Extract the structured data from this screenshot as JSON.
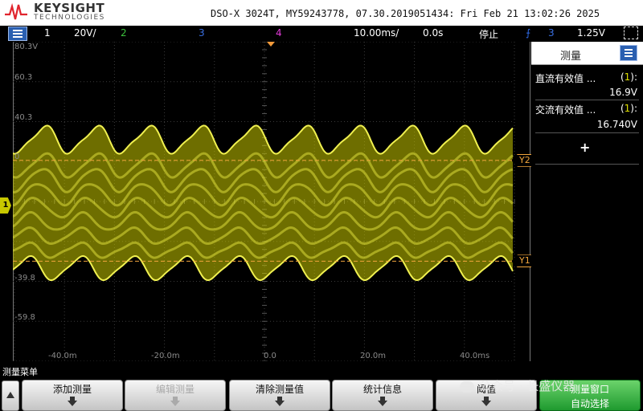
{
  "header": {
    "brand": "KEYSIGHT",
    "brand_sub": "TECHNOLOGIES",
    "scope_info": "DSO-X 3024T, MY59243778, 07.30.2019051434: Fri Feb 21 13:02:26 2025"
  },
  "statusbar": {
    "ch1_num": "1",
    "ch1_scale": "20V/",
    "ch2_num": "2",
    "ch3_num": "3",
    "ch4_num": "4",
    "timebase": "10.00ms/",
    "delay": "0.0s",
    "run_state": "停止",
    "trigger_source": "3",
    "trigger_level": "1.25V"
  },
  "plot": {
    "y_labels": [
      "80.3V",
      "60.3",
      "40.3",
      "0",
      "-39.8",
      "-59.8"
    ],
    "x_labels": [
      "-40.0m",
      "-20.0m",
      "0.0",
      "20.0m",
      "40.0ms"
    ],
    "cursor_y2_label": "Y2",
    "cursor_y1_label": "Y1",
    "ch1_marker": "1",
    "waveform_color": "#c8c800",
    "cursor_color": "#f0a53c",
    "cursor_y2_level": 20.9,
    "cursor_y1_level": -29.6,
    "y_range": [
      -79.7,
      80.3
    ]
  },
  "panel": {
    "title": "测量",
    "measurements": [
      {
        "label": "直流有效值 ...",
        "source": "1",
        "value": "16.9V"
      },
      {
        "label": "交流有效值 ...",
        "source": "1",
        "value": "16.740V"
      }
    ],
    "add_symbol": "+"
  },
  "softkeys": {
    "menu_title": "测量菜单",
    "keys": [
      {
        "label": "添加测量"
      },
      {
        "label": "编辑测量"
      },
      {
        "label": "清除测量值"
      },
      {
        "label": "统计信息"
      },
      {
        "label": "阈值"
      },
      {
        "label": "测量窗口",
        "value": "自动选择"
      }
    ]
  },
  "watermark": {
    "text": "公众号 · 长盛仪器"
  }
}
